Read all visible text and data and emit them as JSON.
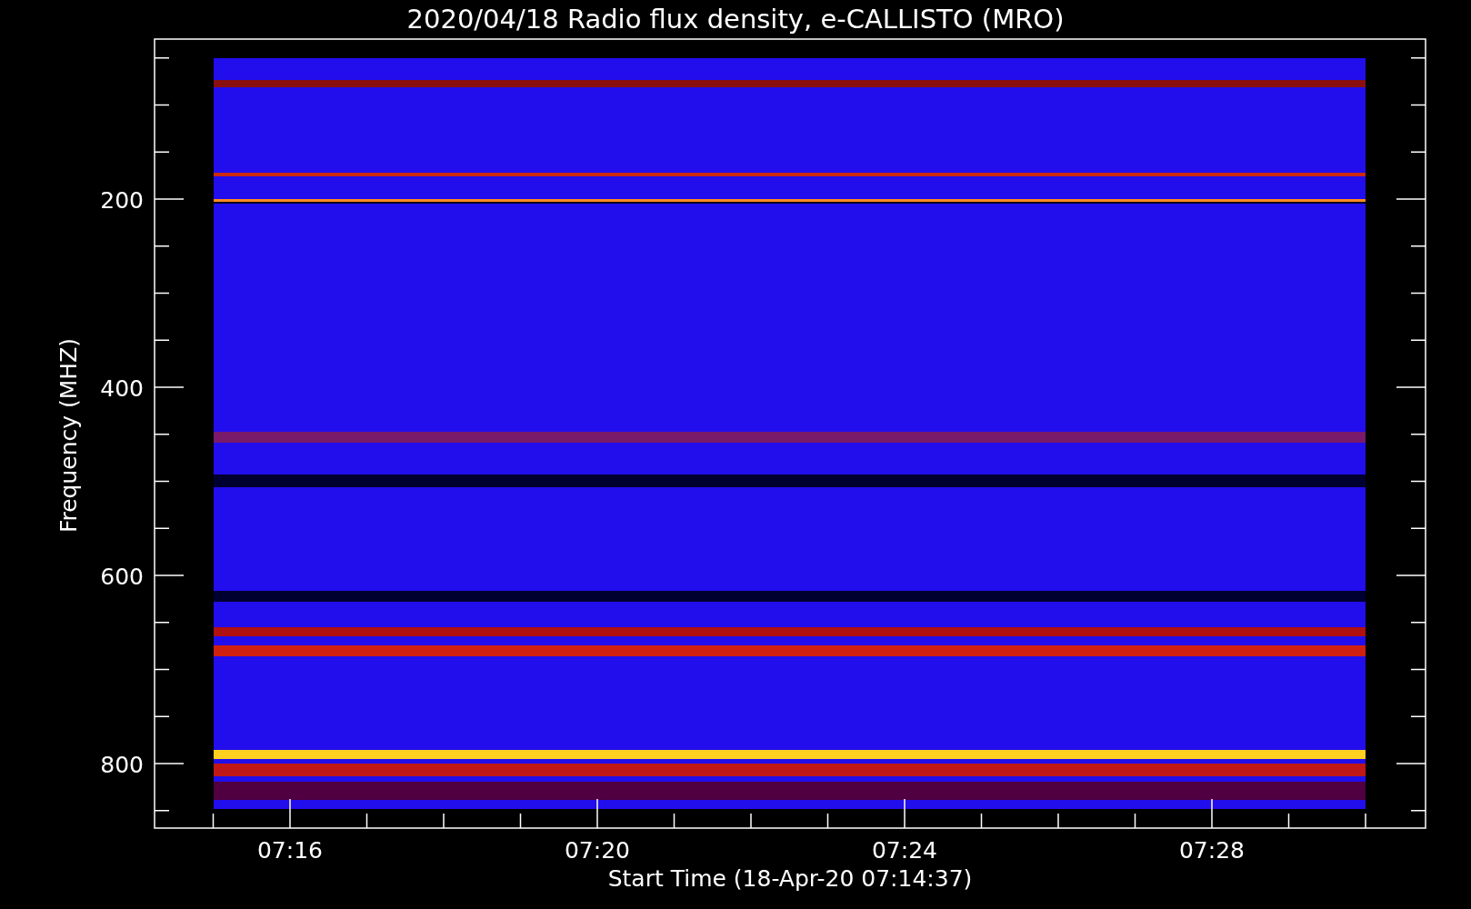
{
  "title": "2020/04/18  Radio flux density, e-CALLISTO (MRO)",
  "ylabel": "Frequency (MHZ)",
  "xlabel": "Start Time (18-Apr-20 07:14:37)",
  "yticks": [
    "200",
    "400",
    "600",
    "800"
  ],
  "xticks": [
    "07:16",
    "07:20",
    "07:24",
    "07:28"
  ]
}
